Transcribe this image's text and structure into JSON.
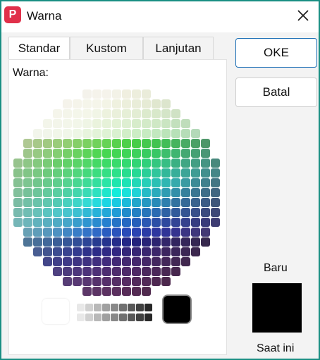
{
  "window": {
    "title": "Warna",
    "app_icon": "app-logo-icon",
    "close_icon": "close-icon"
  },
  "tabs": [
    {
      "label": "Standar",
      "active": true
    },
    {
      "label": "Kustom",
      "active": false
    },
    {
      "label": "Lanjutan",
      "active": false
    }
  ],
  "panel": {
    "label": "Warna:"
  },
  "buttons": {
    "ok": "OKE",
    "cancel": "Batal"
  },
  "preview": {
    "new_label": "Baru",
    "current_label": "Saat ini",
    "new_color": "#000000",
    "current_color": "#000000"
  },
  "accent_color": "#1a8f83"
}
